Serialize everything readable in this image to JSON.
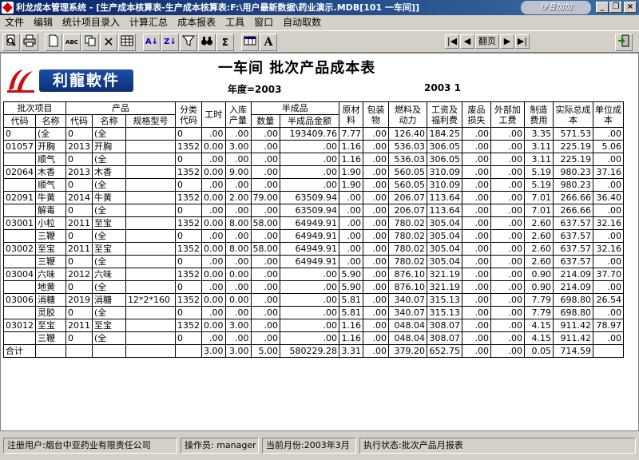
{
  "window": {
    "title": "利龙成本管理系统 - [生产成本核算表-生产成本核算表:F:\\用户最新数据\\药业演示.MDB[101 一车间]]",
    "ime_label": "拼音加加"
  },
  "menu": [
    "文件",
    "编辑",
    "统计项目录入",
    "计算汇总",
    "成本报表",
    "工具",
    "窗口",
    "自动取数"
  ],
  "toolbar": {
    "sort_asc_label": "A",
    "sort_desc_label": "Z",
    "sum_label": "Σ",
    "font_label": "A",
    "page_label": "翻页"
  },
  "logo": {
    "text": "利龍軟件"
  },
  "report": {
    "title": "一车间  批次产品成本表",
    "year_label": "年度=2003",
    "period_label": "2003  1"
  },
  "table": {
    "group_headers": {
      "batch": "批次项目",
      "product": "产品",
      "semi": "半成品"
    },
    "headers": {
      "batch_code": "代码",
      "batch_name": "名称",
      "prod_code": "代码",
      "prod_name": "名称",
      "spec": "规格型号",
      "class_code": "分类代码",
      "work_hours": "工时",
      "in_qty": "入库产量",
      "semi_qty": "数量",
      "semi_amount": "半成品金额",
      "material": "原材料",
      "packaging": "包装物",
      "fuel": "燃料及动力",
      "wages": "工资及福利费",
      "scrap": "废品损失",
      "outsourcing": "外部加工费",
      "manufacturing": "制造费用",
      "total": "实际总成本",
      "unit_cost": "单位成本"
    },
    "rows": [
      [
        "0",
        "(全",
        "0",
        "(全",
        "",
        "0",
        ".00",
        ".00",
        ".00",
        "193409.76",
        "7.77",
        ".00",
        "126.40",
        "184.25",
        ".00",
        ".00",
        "3.35",
        "571.53",
        ".00"
      ],
      [
        "01057",
        "开胸",
        "2013",
        "开胸",
        "",
        "1352",
        "0.00",
        "3.00",
        ".00",
        ".00",
        "1.16",
        ".00",
        "536.03",
        "306.05",
        ".00",
        ".00",
        "3.11",
        "225.19",
        "5.06"
      ],
      [
        "",
        "顺气",
        "0",
        "(全",
        "",
        "0",
        ".00",
        ".00",
        ".00",
        ".00",
        "1.16",
        ".00",
        "536.03",
        "306.05",
        ".00",
        ".00",
        "3.11",
        "225.19",
        ".00"
      ],
      [
        "02064",
        "木香",
        "2013",
        "木香",
        "",
        "1352",
        "0.00",
        "9.00",
        ".00",
        ".00",
        "1.90",
        ".00",
        "560.05",
        "310.09",
        ".00",
        ".00",
        "5.19",
        "980.23",
        "37.16"
      ],
      [
        "",
        "顺气",
        "0",
        "(全",
        "",
        "0",
        ".00",
        ".00",
        ".00",
        ".00",
        "1.90",
        ".00",
        "560.05",
        "310.09",
        ".00",
        ".00",
        "5.19",
        "980.23",
        ".00"
      ],
      [
        "02091",
        "牛黄",
        "2014",
        "牛黄",
        "",
        "1352",
        "0.00",
        "2.00",
        "79.00",
        "63509.94",
        ".00",
        ".00",
        "206.07",
        "113.64",
        ".00",
        ".00",
        "7.01",
        "266.66",
        "36.40"
      ],
      [
        "",
        "解毒",
        "0",
        "(全",
        "",
        "0",
        ".00",
        ".00",
        ".00",
        "63509.94",
        ".00",
        ".00",
        "206.07",
        "113.64",
        ".00",
        ".00",
        "7.01",
        "266.66",
        ".00"
      ],
      [
        "03001",
        "小粒",
        "2011",
        "至宝",
        "",
        "1352",
        "0.00",
        "8.00",
        "58.00",
        "64949.91",
        ".00",
        ".00",
        "780.02",
        "305.04",
        ".00",
        ".00",
        "2.60",
        "637.57",
        "32.16"
      ],
      [
        "",
        "三鞭",
        "0",
        "(全",
        "",
        "0",
        ".00",
        ".00",
        ".00",
        "64949.91",
        ".00",
        ".00",
        "780.02",
        "305.04",
        ".00",
        ".00",
        "2.60",
        "637.57",
        ".00"
      ],
      [
        "03002",
        "至宝",
        "2011",
        "至宝",
        "",
        "1352",
        "0.00",
        "8.00",
        "58.00",
        "64949.91",
        ".00",
        ".00",
        "780.02",
        "305.04",
        ".00",
        ".00",
        "2.60",
        "637.57",
        "32.16"
      ],
      [
        "",
        "三鞭",
        "0",
        "(全",
        "",
        "0",
        ".00",
        ".00",
        ".00",
        "64949.91",
        ".00",
        ".00",
        "780.02",
        "305.04",
        ".00",
        ".00",
        "2.60",
        "637.57",
        ".00"
      ],
      [
        "03004",
        "六味",
        "2012",
        "六味",
        "",
        "1352",
        "0.00",
        "0.00",
        ".00",
        ".00",
        "5.90",
        ".00",
        "876.10",
        "321.19",
        ".00",
        ".00",
        "0.90",
        "214.09",
        "37.70"
      ],
      [
        "",
        "地黄",
        "0",
        "(全",
        "",
        "0",
        ".00",
        ".00",
        ".00",
        ".00",
        "5.90",
        ".00",
        "876.10",
        "321.19",
        ".00",
        ".00",
        "0.90",
        "214.09",
        ".00"
      ],
      [
        "03006",
        "消糖",
        "2019",
        "消糖",
        "12*2*160",
        "1352",
        "0.00",
        "0.00",
        ".00",
        ".00",
        "5.81",
        ".00",
        "340.07",
        "315.13",
        ".00",
        ".00",
        "7.79",
        "698.80",
        "26.54"
      ],
      [
        "",
        "灵胶",
        "0",
        "(全",
        "",
        "0",
        ".00",
        ".00",
        ".00",
        ".00",
        "5.81",
        ".00",
        "340.07",
        "315.13",
        ".00",
        ".00",
        "7.79",
        "698.80",
        ".00"
      ],
      [
        "03012",
        "至宝",
        "2011",
        "至宝",
        "",
        "1352",
        "0.00",
        "3.00",
        ".00",
        ".00",
        "1.16",
        ".00",
        "048.04",
        "308.07",
        ".00",
        ".00",
        "4.15",
        "911.42",
        "78.97"
      ],
      [
        "",
        "三鞭",
        "0",
        "(全",
        "",
        "0",
        ".00",
        ".00",
        ".00",
        ".00",
        "1.16",
        ".00",
        "048.04",
        "308.07",
        ".00",
        ".00",
        "4.15",
        "911.42",
        ".00"
      ]
    ],
    "total_row": [
      "合计",
      "",
      "",
      "",
      "",
      "",
      "3.00",
      "3.00",
      "5.00",
      "580229.28",
      "3.31",
      ".00",
      "379.20",
      "652.75",
      ".00",
      ".00",
      "0.05",
      "714.59",
      ""
    ]
  },
  "status": {
    "user": "注册用户:烟台中亚药业有限责任公司",
    "operator": "操作员: manager",
    "month": "当前月份:2003年3月",
    "state": "执行状态:批次产品月报表"
  }
}
